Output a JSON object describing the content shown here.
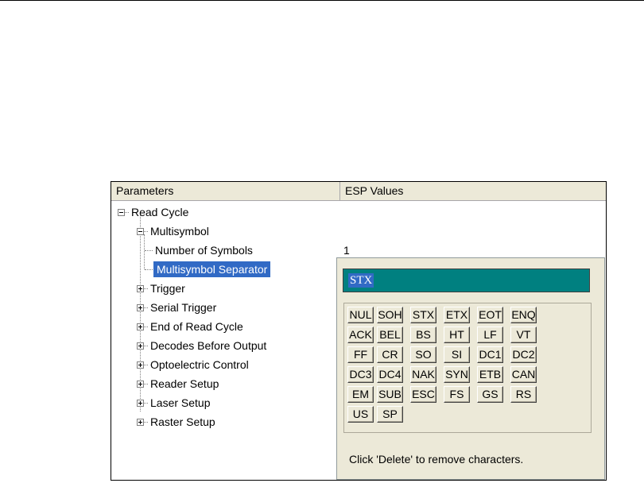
{
  "header": {
    "col_params": "Parameters",
    "col_values": "ESP Values"
  },
  "tree": {
    "read_cycle": "Read Cycle",
    "multisymbol": "Multisymbol",
    "number_of_symbols": "Number of Symbols",
    "number_of_symbols_value": "1",
    "multisymbol_separator": "Multisymbol Separator",
    "items": [
      "Trigger",
      "Serial Trigger",
      "End of Read Cycle",
      "Decodes Before Output",
      "Optoelectric Control",
      "Reader Setup",
      "Laser Setup",
      "Raster Setup"
    ]
  },
  "editor": {
    "field_value": "STX",
    "keys": [
      [
        "NUL",
        "SOH",
        "STX",
        "ETX",
        "EOT",
        "ENQ"
      ],
      [
        "ACK",
        "BEL",
        "BS",
        "HT",
        "LF",
        "VT"
      ],
      [
        "FF",
        "CR",
        "SO",
        "SI",
        "DC1",
        "DC2"
      ],
      [
        "DC3",
        "DC4",
        "NAK",
        "SYN",
        "ETB",
        "CAN"
      ],
      [
        "EM",
        "SUB",
        "ESC",
        "FS",
        "GS",
        "RS"
      ],
      [
        "US",
        "SP"
      ]
    ],
    "hint": "Click 'Delete' to remove characters."
  },
  "colors": {
    "selection": "#316ac5",
    "field_bg": "#008080",
    "dialog_bg": "#ece9d8"
  }
}
